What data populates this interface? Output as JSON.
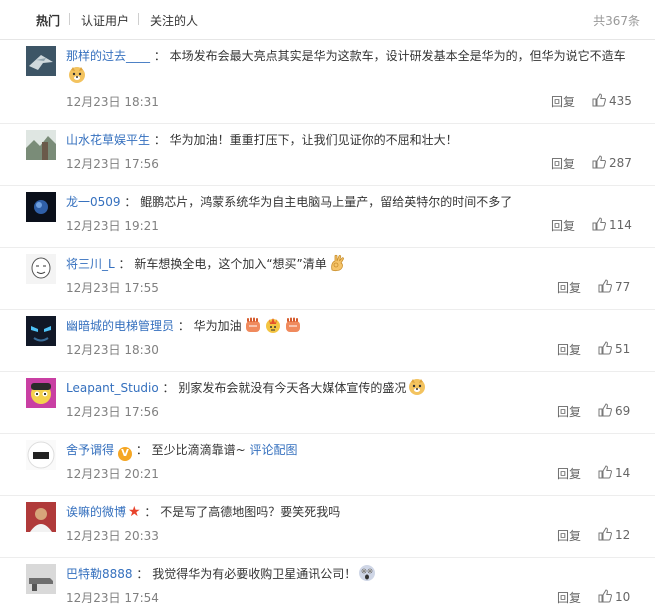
{
  "tabs": [
    {
      "label": "热门",
      "active": true
    },
    {
      "label": "认证用户",
      "active": false
    },
    {
      "label": "关注的人",
      "active": false
    }
  ],
  "total": "共367条",
  "reply_label": "回复",
  "comments": [
    {
      "user": "那样的过去____",
      "text": "本场发布会最大亮点其实是华为这款车，设计研发基本全是华为的，但华为说它不造车",
      "emojis": [
        "doge"
      ],
      "time": "12月23日 18:31",
      "likes": "435"
    },
    {
      "user": "山水花草娱平生",
      "text": "华为加油！重重打压下，让我们见证你的不屈和壮大！",
      "emojis": [],
      "time": "12月23日 17:56",
      "likes": "287"
    },
    {
      "user": "龙一0509",
      "text": "鲲鹏芯片，鸿蒙系统华为自主电脑马上量产，留给英特尔的时间不多了",
      "emojis": [],
      "time": "12月23日 19:21",
      "likes": "114"
    },
    {
      "user": "将三川_L",
      "text": "新车想换全电，这个加入“想买”清单",
      "emojis": [
        "ok"
      ],
      "time": "12月23日 17:55",
      "likes": "77"
    },
    {
      "user": "幽暗城的电梯管理员",
      "text": "华为加油",
      "emojis": [
        "fist",
        "fire",
        "fist"
      ],
      "time": "12月23日 18:30",
      "likes": "51"
    },
    {
      "user": "Leapant_Studio",
      "text": "别家发布会就没有今天各大媒体宣传的盛况",
      "emojis": [
        "doge"
      ],
      "time": "12月23日 17:56",
      "likes": "69"
    },
    {
      "user": "舍予谓得",
      "text": "至少比滴滴靠谱~",
      "topic": "评论配图",
      "badge": "V",
      "emojis": [],
      "time": "12月23日 20:21",
      "likes": "14"
    },
    {
      "user": "诶嘛的微博",
      "text": "不是写了高德地图吗？要笑死我吗",
      "star": "★",
      "emojis": [],
      "time": "12月23日 20:33",
      "likes": "12"
    },
    {
      "user": "巴特勒8888",
      "text": "我觉得华为有必要收购卫星通讯公司！",
      "emojis": [
        "shock"
      ],
      "time": "12月23日 17:54",
      "likes": "10"
    }
  ],
  "colors": {
    "link": "#3570be",
    "meta": "#808080",
    "badge": "#f5a623",
    "star": "#e8432c"
  }
}
